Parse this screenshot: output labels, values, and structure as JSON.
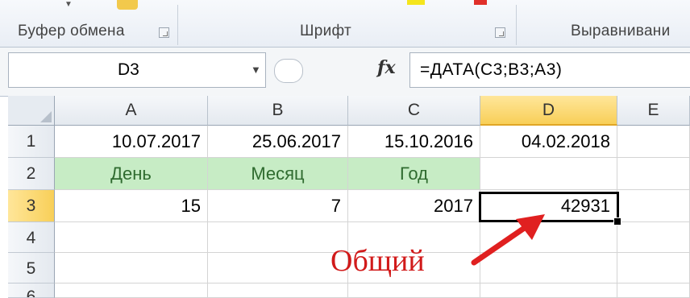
{
  "ribbon": {
    "groups": [
      {
        "label": "Буфер обмена"
      },
      {
        "label": "Шрифт"
      },
      {
        "label": "Выравнивани"
      }
    ]
  },
  "formula_bar": {
    "name_box": "D3",
    "fx_label": "fx",
    "formula": "=ДАТА(C3;B3;A3)"
  },
  "sheet": {
    "columns": [
      "A",
      "B",
      "C",
      "D",
      "E"
    ],
    "rows": [
      "1",
      "2",
      "3",
      "4",
      "5",
      "6"
    ],
    "active_cell": "D3",
    "cells": {
      "A1": "10.07.2017",
      "B1": "25.06.2017",
      "C1": "15.10.2016",
      "D1": "04.02.2018",
      "A2": "День",
      "B2": "Месяц",
      "C2": "Год",
      "A3": "15",
      "B3": "7",
      "C3": "2017",
      "D3": "42931"
    }
  },
  "annotation": {
    "text": "Общий",
    "color": "#d11a1a"
  },
  "colors": {
    "header_highlight": "#f8cf58",
    "label_fill": "#c7ecc5"
  }
}
